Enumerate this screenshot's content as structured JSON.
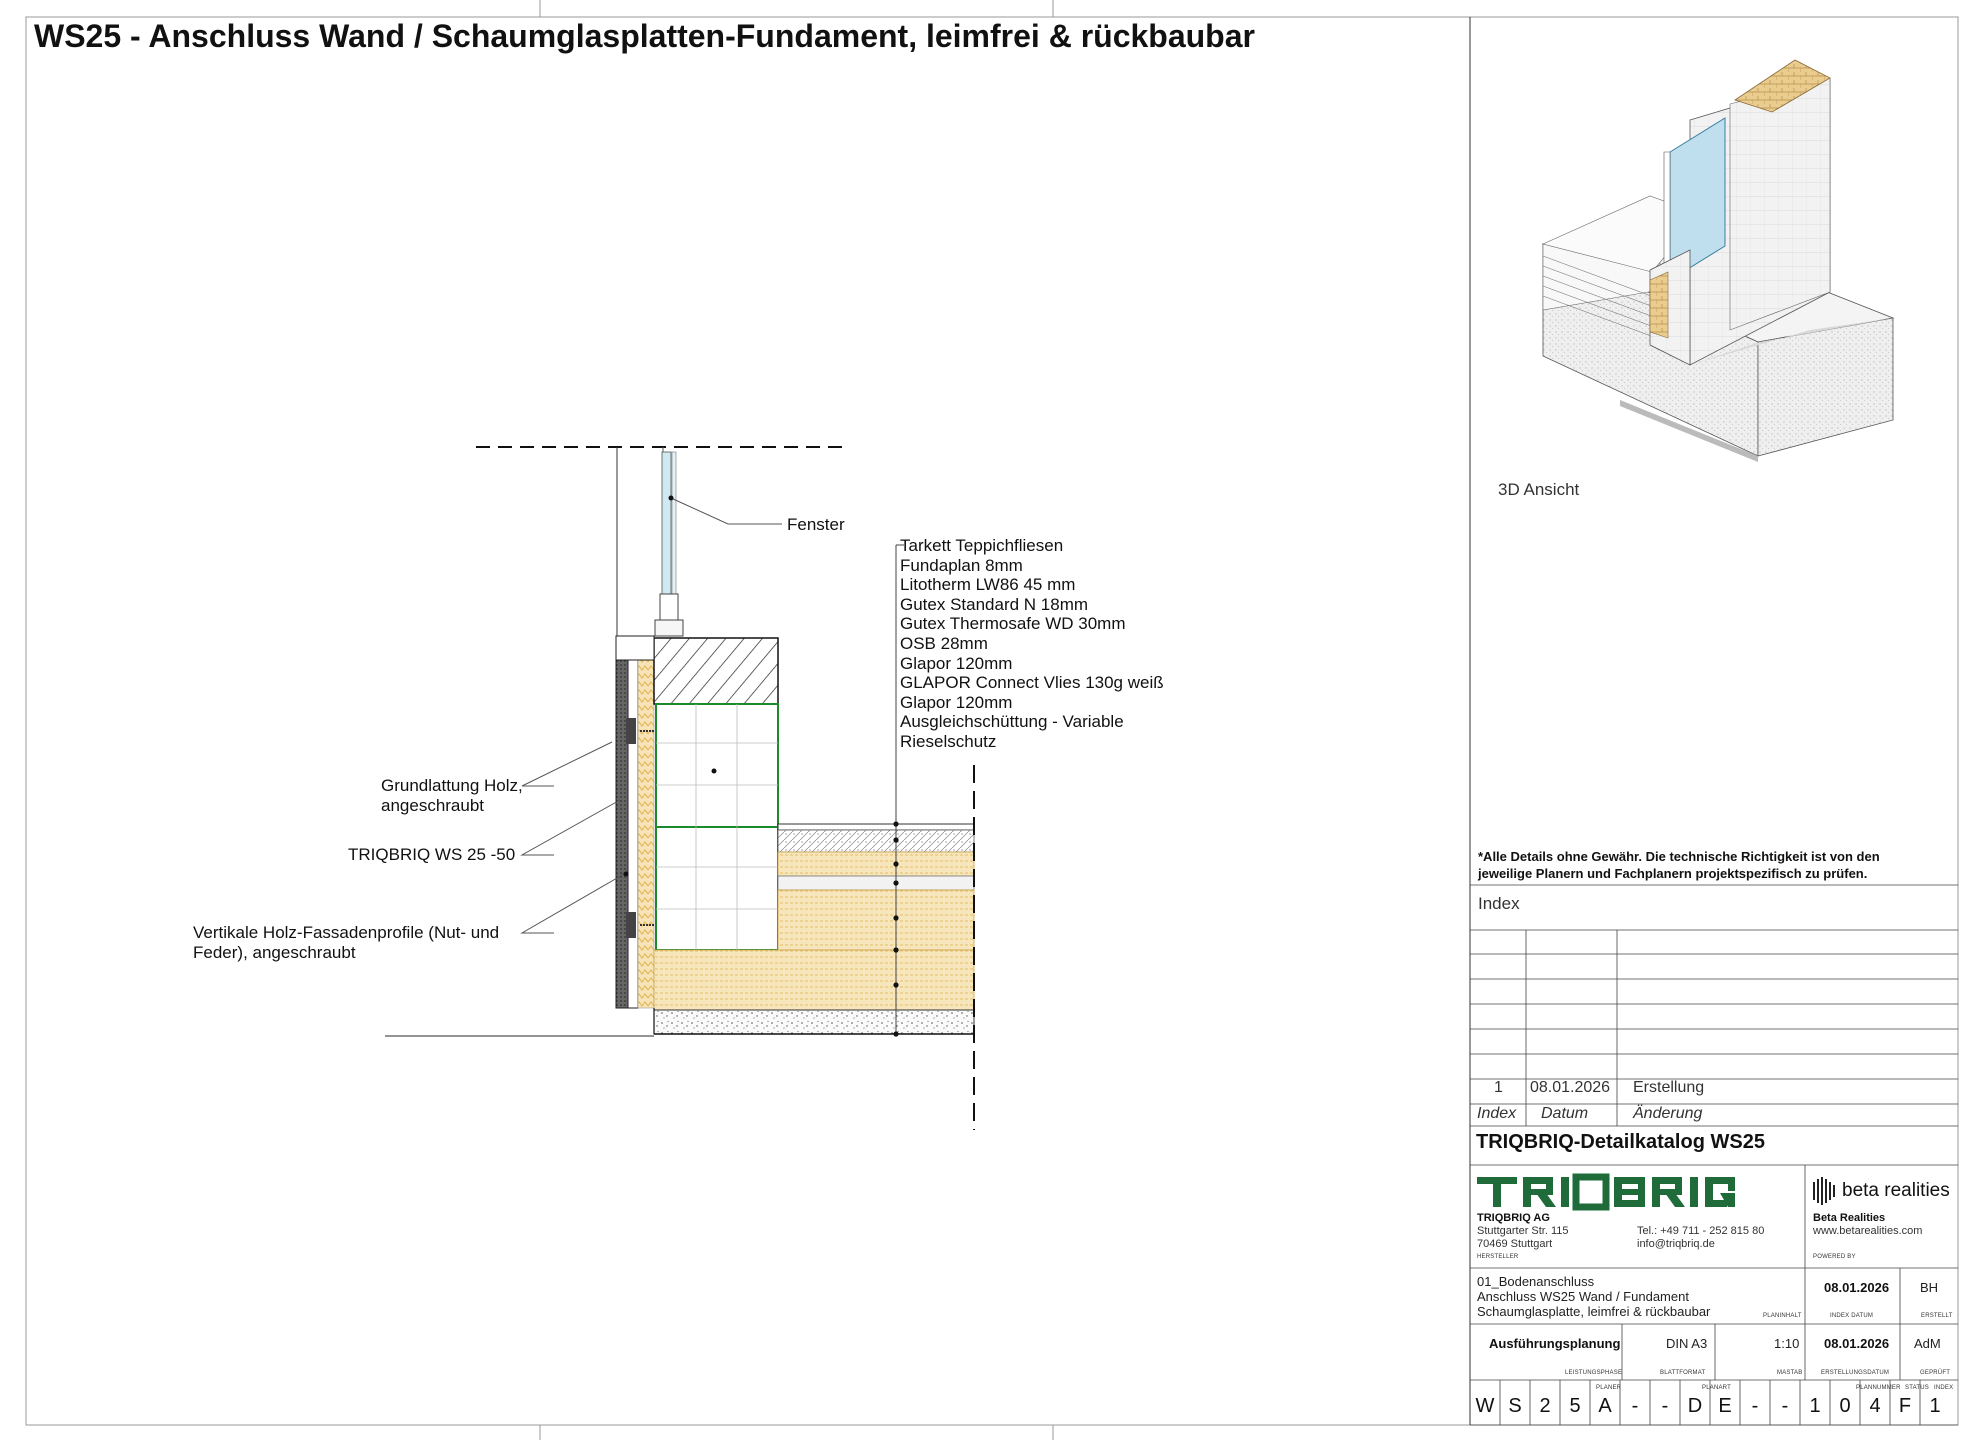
{
  "title": "WS25 - Anschluss Wand / Schaumglasplatten-Fundament, leimfrei & rückbaubar",
  "labels": {
    "fenster": "Fenster",
    "grundlattung": [
      "Grundlattung Holz,",
      "angeschraubt"
    ],
    "triqbriq": "TRIQBRIQ WS 25 -50",
    "vertikale": [
      "Vertikale Holz-Fassadenprofile (Nut- und",
      "Feder), angeschraubt"
    ]
  },
  "layers": [
    "Tarkett Teppichfliesen",
    "Fundaplan 8mm",
    "Litotherm LW86 45 mm",
    "Gutex Standard N 18mm",
    "Gutex Thermosafe WD 30mm",
    "OSB  28mm",
    "Glapor 120mm",
    "GLAPOR Connect Vlies 130g weiß",
    "Glapor 120mm",
    "Ausgleichschüttung - Variable",
    "Rieselschutz"
  ],
  "view3d_caption": "3D Ansicht",
  "disclaimer": "*Alle Details ohne Gewähr. Die technische Richtigkeit ist von den jeweilige Planern und Fachplanern projektspezifisch zu prüfen.",
  "index": {
    "header": "Index",
    "rows": [
      {
        "nr": "1",
        "datum": "08.01.2026",
        "aenderung": "Erstellung"
      }
    ],
    "col_index": "Index",
    "col_datum": "Datum",
    "col_aenderung": "Änderung"
  },
  "katalog": "TRIQBRIQ-Detailkatalog WS25",
  "manufacturer": {
    "logo": "TRIQBRIQ",
    "name": "TRIQBRIQ AG",
    "street": "Stuttgarter Str. 115",
    "city": "70469 Stuttgart",
    "tel": "Tel.: +49 711 - 252 815 80",
    "email": "info@triqbriq.de",
    "role": "HERSTELLER"
  },
  "powered": {
    "logo": "beta realities",
    "name": "Beta Realities",
    "web": "www.betarealities.com",
    "role": "POWERED BY"
  },
  "planinhalt": {
    "lines": [
      "01_Bodenanschluss",
      "Anschluss WS25 Wand / Fundament",
      "Schaumglasplatte, leimfrei & rückbaubar"
    ],
    "label": "PLANINHALT",
    "index_datum": "08.01.2026",
    "index_datum_label": "INDEX DATUM",
    "erstellt": "BH",
    "erstellt_label": "ERSTELLT"
  },
  "phase": {
    "leistungsphase": "Ausführungsplanung",
    "leistungsphase_label": "LEISTUNGSPHASE",
    "blattformat": "DIN A3",
    "blattformat_label": "BLATTFORMAT",
    "massstab": "1:10",
    "massstab_label": "MASTAB",
    "erstellungsdatum": "08.01.2026",
    "erstellungsdatum_label": "ERSTELLUNGSDATUM",
    "geprueft": "AdM",
    "geprueft_label": "GEPRÜFT"
  },
  "code_labels": [
    "PLANER",
    "PLANART",
    "PLANNUMMER",
    "STATUS",
    "INDEX"
  ],
  "plan_code": [
    "W",
    "S",
    "2",
    "5",
    "A",
    "-",
    "-",
    "D",
    "E",
    "-",
    "-",
    "1",
    "0",
    "4",
    "F",
    "1"
  ],
  "colors": {
    "insulation": "#f4e2b2",
    "frame": "#1a8a2a",
    "glass": "#bfe0ee",
    "brick": "#e8c98a"
  }
}
